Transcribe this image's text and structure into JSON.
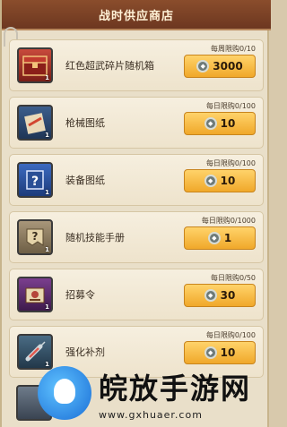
{
  "header": {
    "title": "战时供应商店"
  },
  "items": [
    {
      "name": "红色超武碎片随机箱",
      "limit": "每周限购0/10",
      "price": "3000",
      "count": "1",
      "icon": "red-crate-icon",
      "color": "#b2322a"
    },
    {
      "name": "枪械图纸",
      "limit": "每日限购0/100",
      "price": "10",
      "count": "1",
      "icon": "gun-blueprint-icon",
      "color": "#2f4f7f"
    },
    {
      "name": "装备图纸",
      "limit": "每日限购0/100",
      "price": "10",
      "count": "1",
      "icon": "mystery-blueprint-icon",
      "color": "#2a4f96"
    },
    {
      "name": "随机技能手册",
      "limit": "每日限购0/1000",
      "price": "1",
      "count": "1",
      "icon": "skill-manual-icon",
      "color": "#8c7b5a"
    },
    {
      "name": "招募令",
      "limit": "每日限购0/50",
      "price": "30",
      "count": "1",
      "icon": "recruit-order-icon",
      "color": "#5b2a6e"
    },
    {
      "name": "强化补剂",
      "limit": "每日限购0/100",
      "price": "10",
      "count": "1",
      "icon": "syringe-icon",
      "color": "#3d5a6e"
    }
  ],
  "watermark": {
    "cn": "皖放手游网",
    "url": "www.gxhuaer.com"
  }
}
